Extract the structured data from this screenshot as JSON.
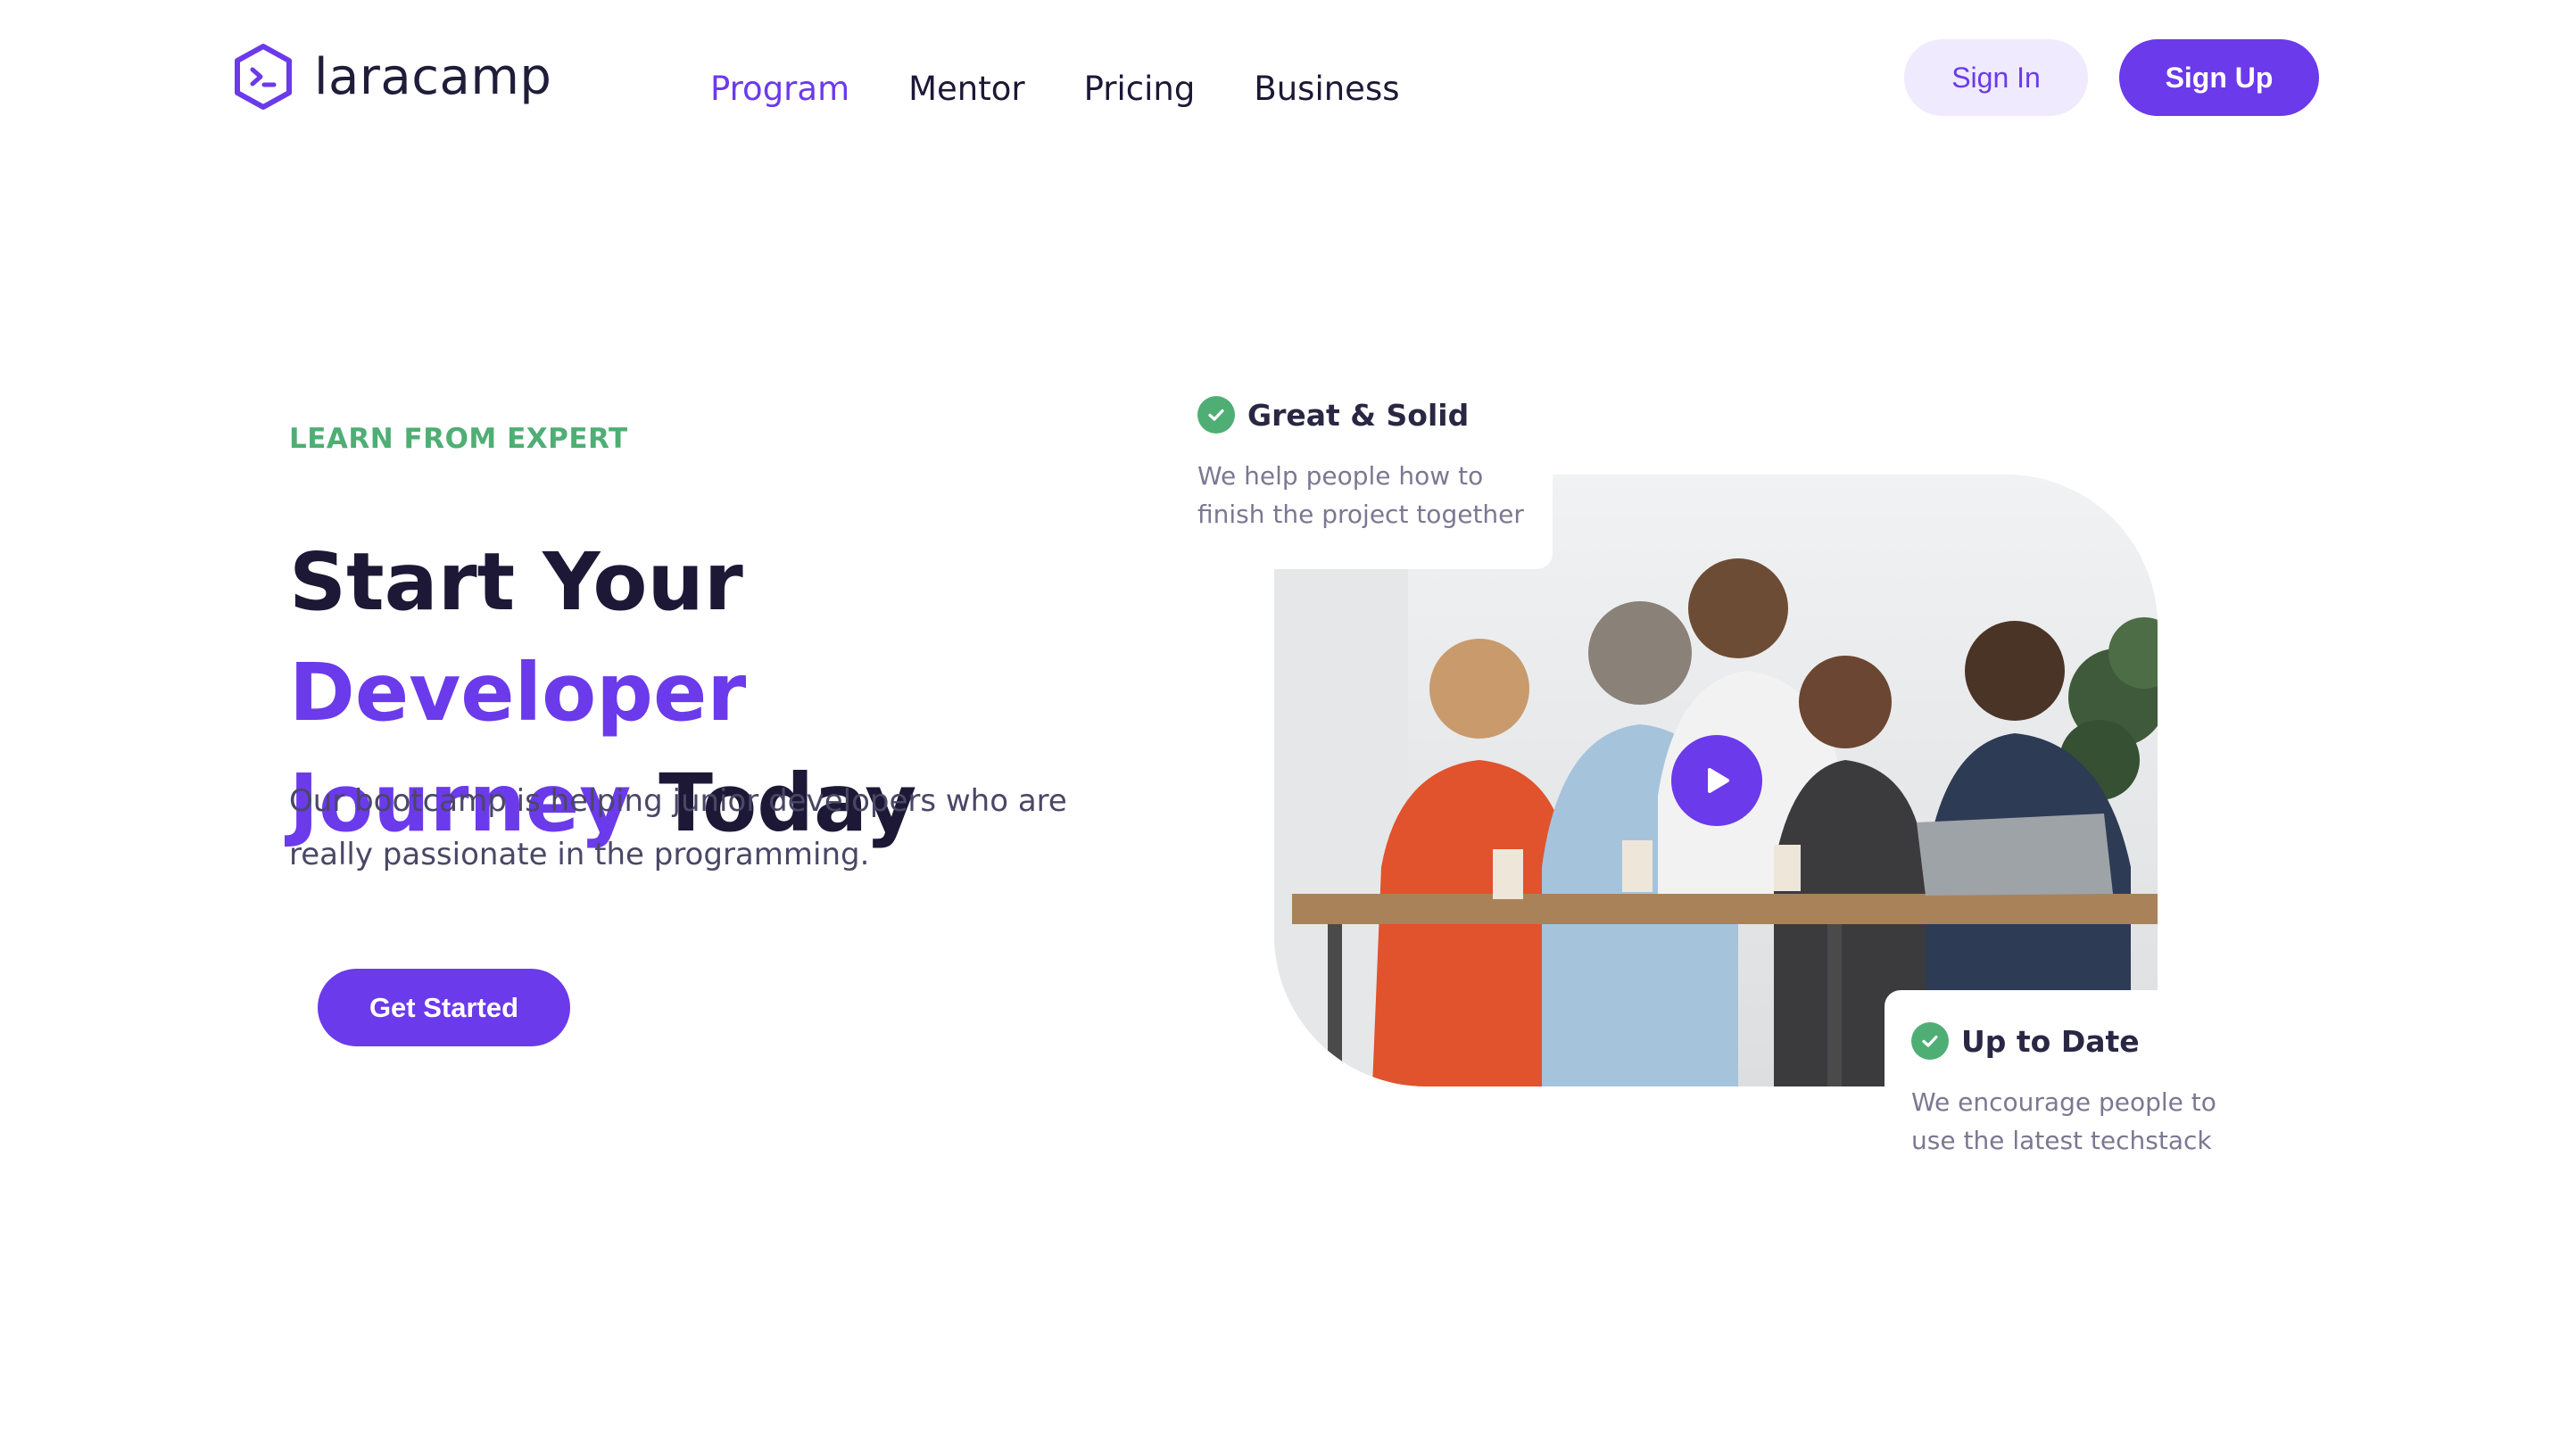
{
  "brand": {
    "name": "laracamp"
  },
  "nav": {
    "items": [
      {
        "label": "Program",
        "active": true
      },
      {
        "label": "Mentor",
        "active": false
      },
      {
        "label": "Pricing",
        "active": false
      },
      {
        "label": "Business",
        "active": false
      }
    ]
  },
  "auth": {
    "sign_in": "Sign In",
    "sign_up": "Sign Up"
  },
  "hero": {
    "eyebrow": "LEARN FROM EXPERT",
    "headline_part1": "Start Your ",
    "headline_accent1": "Developer",
    "headline_accent2": "Journey",
    "headline_part2": " Today",
    "subtext": "Our bootcamp is helping junior developers who are really passionate in the programming.",
    "cta": "Get Started"
  },
  "features": [
    {
      "title": "Great & Solid",
      "text": "We help people how to finish the project together",
      "icon": "check-circle-icon"
    },
    {
      "title": "Up to Date",
      "text": "We encourage people to use the latest techstack",
      "icon": "check-circle-icon"
    }
  ],
  "colors": {
    "accent": "#6b3aeb",
    "success": "#4fae74",
    "text": "#1c1836",
    "muted": "#7b7892"
  }
}
